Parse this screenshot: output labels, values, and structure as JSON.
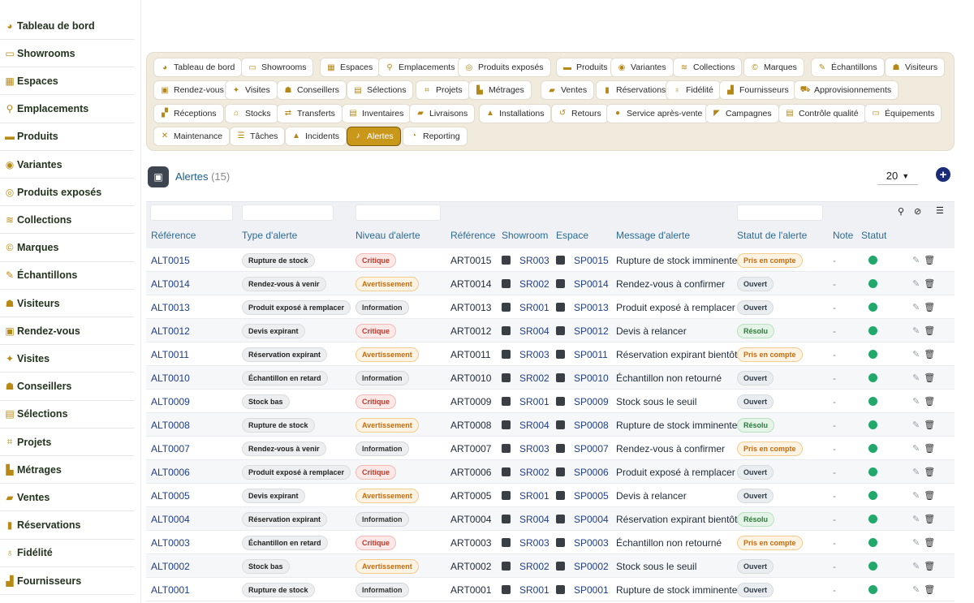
{
  "sidebar": {
    "items": [
      {
        "label": "Tableau de bord",
        "icon": "dashboard-icon",
        "glyph": "◕"
      },
      {
        "label": "Showrooms",
        "icon": "showroom-icon",
        "glyph": "▭"
      },
      {
        "label": "Espaces",
        "icon": "grid-icon",
        "glyph": "▦"
      },
      {
        "label": "Emplacements",
        "icon": "location-pin-icon",
        "glyph": "⚲"
      },
      {
        "label": "Produits",
        "icon": "couch-icon",
        "glyph": "▬"
      },
      {
        "label": "Variantes",
        "icon": "palette-icon",
        "glyph": "◉"
      },
      {
        "label": "Produits exposés",
        "icon": "eye-icon",
        "glyph": "◎"
      },
      {
        "label": "Collections",
        "icon": "layers-icon",
        "glyph": "≋"
      },
      {
        "label": "Marques",
        "icon": "copyright-icon",
        "glyph": "©"
      },
      {
        "label": "Échantillons",
        "icon": "swatch-icon",
        "glyph": "✎"
      },
      {
        "label": "Visiteurs",
        "icon": "users-icon",
        "glyph": "☗"
      },
      {
        "label": "Rendez-vous",
        "icon": "calendar-icon",
        "glyph": "▣"
      },
      {
        "label": "Visites",
        "icon": "walking-icon",
        "glyph": "✦"
      },
      {
        "label": "Conseillers",
        "icon": "user-tie-icon",
        "glyph": "☗"
      },
      {
        "label": "Sélections",
        "icon": "clipboard-icon",
        "glyph": "▤"
      },
      {
        "label": "Projets",
        "icon": "diagram-icon",
        "glyph": "⌗"
      },
      {
        "label": "Métrages",
        "icon": "ruler-icon",
        "glyph": "▙"
      },
      {
        "label": "Ventes",
        "icon": "truck-icon",
        "glyph": "▰"
      },
      {
        "label": "Réservations",
        "icon": "bookmark-icon",
        "glyph": "▮"
      },
      {
        "label": "Fidélité",
        "icon": "award-icon",
        "glyph": "♁"
      },
      {
        "label": "Fournisseurs",
        "icon": "industry-icon",
        "glyph": "▟"
      }
    ]
  },
  "modules": {
    "chips": [
      {
        "label": "Tableau de bord",
        "icon": "dashboard-icon",
        "glyph": "◕",
        "active": false
      },
      {
        "label": "Showrooms",
        "icon": "showroom-icon",
        "glyph": "▭",
        "active": false
      },
      {
        "label": "Espaces",
        "icon": "grid-icon",
        "glyph": "▦",
        "active": false
      },
      {
        "label": "Emplacements",
        "icon": "location-pin-icon",
        "glyph": "⚲",
        "active": false
      },
      {
        "label": "Produits exposés",
        "icon": "eye-icon",
        "glyph": "◎",
        "active": false
      },
      {
        "label": "Produits",
        "icon": "couch-icon",
        "glyph": "▬",
        "active": false
      },
      {
        "label": "Variantes",
        "icon": "palette-icon",
        "glyph": "◉",
        "active": false
      },
      {
        "label": "Collections",
        "icon": "layers-icon",
        "glyph": "≋",
        "active": false
      },
      {
        "label": "Marques",
        "icon": "copyright-icon",
        "glyph": "©",
        "active": false
      },
      {
        "label": "Échantillons",
        "icon": "swatch-icon",
        "glyph": "✎",
        "active": false
      },
      {
        "label": "Visiteurs",
        "icon": "users-icon",
        "glyph": "☗",
        "active": false
      },
      {
        "label": "Rendez-vous",
        "icon": "calendar-icon",
        "glyph": "▣",
        "active": false
      },
      {
        "label": "Visites",
        "icon": "walking-icon",
        "glyph": "✦",
        "active": false
      },
      {
        "label": "Conseillers",
        "icon": "user-tie-icon",
        "glyph": "☗",
        "active": false
      },
      {
        "label": "Sélections",
        "icon": "clipboard-icon",
        "glyph": "▤",
        "active": false
      },
      {
        "label": "Projets",
        "icon": "diagram-icon",
        "glyph": "⌗",
        "active": false
      },
      {
        "label": "Métrages",
        "icon": "ruler-icon",
        "glyph": "▙",
        "active": false
      },
      {
        "label": "Ventes",
        "icon": "truck-icon",
        "glyph": "▰",
        "active": false
      },
      {
        "label": "Réservations",
        "icon": "bookmark-icon",
        "glyph": "▮",
        "active": false
      },
      {
        "label": "Fidélité",
        "icon": "award-icon",
        "glyph": "♁",
        "active": false
      },
      {
        "label": "Fournisseurs",
        "icon": "industry-icon",
        "glyph": "▟",
        "active": false
      },
      {
        "label": "Approvisionnements",
        "icon": "cart-icon",
        "glyph": "⛟",
        "active": false
      },
      {
        "label": "Réceptions",
        "icon": "dolly-icon",
        "glyph": "▞",
        "active": false
      },
      {
        "label": "Stocks",
        "icon": "warehouse-icon",
        "glyph": "⌂",
        "active": false
      },
      {
        "label": "Transferts",
        "icon": "exchange-icon",
        "glyph": "⇄",
        "active": false
      },
      {
        "label": "Inventaires",
        "icon": "clipboard-check-icon",
        "glyph": "▤",
        "active": false
      },
      {
        "label": "Livraisons",
        "icon": "delivery-truck-icon",
        "glyph": "▰",
        "active": false
      },
      {
        "label": "Installations",
        "icon": "toolbox-icon",
        "glyph": "▲",
        "active": false
      },
      {
        "label": "Retours",
        "icon": "undo-icon",
        "glyph": "↺",
        "active": false
      },
      {
        "label": "Service après-vente",
        "icon": "comment-icon",
        "glyph": "●",
        "active": false
      },
      {
        "label": "Campagnes",
        "icon": "megaphone-icon",
        "glyph": "◤",
        "active": false
      },
      {
        "label": "Contrôle qualité",
        "icon": "clipboard-check-icon",
        "glyph": "▤",
        "active": false
      },
      {
        "label": "Équipements",
        "icon": "monitor-icon",
        "glyph": "▭",
        "active": false
      },
      {
        "label": "Maintenance",
        "icon": "tools-icon",
        "glyph": "✕",
        "active": false
      },
      {
        "label": "Tâches",
        "icon": "list-icon",
        "glyph": "☰",
        "active": false
      },
      {
        "label": "Incidents",
        "icon": "warning-icon",
        "glyph": "▲",
        "active": false
      },
      {
        "label": "Alertes",
        "icon": "bell-icon",
        "glyph": "♪",
        "active": true
      },
      {
        "label": "Reporting",
        "icon": "pie-chart-icon",
        "glyph": "◔",
        "active": false
      }
    ]
  },
  "header": {
    "title": "Alertes",
    "count": "(15)",
    "page_size": "20",
    "add_label": "+"
  },
  "table": {
    "columns": [
      "Référence",
      "Type d'alerte",
      "Niveau d'alerte",
      "Référence",
      "Showroom",
      "Espace",
      "Message d'alerte",
      "Statut de l'alerte",
      "Note",
      "Statut"
    ],
    "rows": [
      {
        "ref": "ALT0015",
        "type": "Rupture de stock",
        "level": "Critique",
        "art": "ART0015",
        "showroom": "SR003",
        "espace": "SP0015",
        "message": "Rupture de stock imminente",
        "status": "Pris en compte",
        "note": "-"
      },
      {
        "ref": "ALT0014",
        "type": "Rendez-vous à venir",
        "level": "Avertissement",
        "art": "ART0014",
        "showroom": "SR002",
        "espace": "SP0014",
        "message": "Rendez-vous à confirmer",
        "status": "Ouvert",
        "note": "-"
      },
      {
        "ref": "ALT0013",
        "type": "Produit exposé à remplacer",
        "level": "Information",
        "art": "ART0013",
        "showroom": "SR001",
        "espace": "SP0013",
        "message": "Produit exposé à remplacer",
        "status": "Ouvert",
        "note": "-"
      },
      {
        "ref": "ALT0012",
        "type": "Devis expirant",
        "level": "Critique",
        "art": "ART0012",
        "showroom": "SR004",
        "espace": "SP0012",
        "message": "Devis à relancer",
        "status": "Résolu",
        "note": "-"
      },
      {
        "ref": "ALT0011",
        "type": "Réservation expirant",
        "level": "Avertissement",
        "art": "ART0011",
        "showroom": "SR003",
        "espace": "SP0011",
        "message": "Réservation expirant bientôt",
        "status": "Pris en compte",
        "note": "-"
      },
      {
        "ref": "ALT0010",
        "type": "Échantillon en retard",
        "level": "Information",
        "art": "ART0010",
        "showroom": "SR002",
        "espace": "SP0010",
        "message": "Échantillon non retourné",
        "status": "Ouvert",
        "note": "-"
      },
      {
        "ref": "ALT0009",
        "type": "Stock bas",
        "level": "Critique",
        "art": "ART0009",
        "showroom": "SR001",
        "espace": "SP0009",
        "message": "Stock sous le seuil",
        "status": "Ouvert",
        "note": "-"
      },
      {
        "ref": "ALT0008",
        "type": "Rupture de stock",
        "level": "Avertissement",
        "art": "ART0008",
        "showroom": "SR004",
        "espace": "SP0008",
        "message": "Rupture de stock imminente",
        "status": "Résolu",
        "note": "-"
      },
      {
        "ref": "ALT0007",
        "type": "Rendez-vous à venir",
        "level": "Information",
        "art": "ART0007",
        "showroom": "SR003",
        "espace": "SP0007",
        "message": "Rendez-vous à confirmer",
        "status": "Pris en compte",
        "note": "-"
      },
      {
        "ref": "ALT0006",
        "type": "Produit exposé à remplacer",
        "level": "Critique",
        "art": "ART0006",
        "showroom": "SR002",
        "espace": "SP0006",
        "message": "Produit exposé à remplacer",
        "status": "Ouvert",
        "note": "-"
      },
      {
        "ref": "ALT0005",
        "type": "Devis expirant",
        "level": "Avertissement",
        "art": "ART0005",
        "showroom": "SR001",
        "espace": "SP0005",
        "message": "Devis à relancer",
        "status": "Ouvert",
        "note": "-"
      },
      {
        "ref": "ALT0004",
        "type": "Réservation expirant",
        "level": "Information",
        "art": "ART0004",
        "showroom": "SR004",
        "espace": "SP0004",
        "message": "Réservation expirant bientôt",
        "status": "Résolu",
        "note": "-"
      },
      {
        "ref": "ALT0003",
        "type": "Échantillon en retard",
        "level": "Critique",
        "art": "ART0003",
        "showroom": "SR003",
        "espace": "SP0003",
        "message": "Échantillon non retourné",
        "status": "Pris en compte",
        "note": "-"
      },
      {
        "ref": "ALT0002",
        "type": "Stock bas",
        "level": "Avertissement",
        "art": "ART0002",
        "showroom": "SR002",
        "espace": "SP0002",
        "message": "Stock sous le seuil",
        "status": "Ouvert",
        "note": "-"
      },
      {
        "ref": "ALT0001",
        "type": "Rupture de stock",
        "level": "Information",
        "art": "ART0001",
        "showroom": "SR001",
        "espace": "SP0001",
        "message": "Rupture de stock imminente",
        "status": "Ouvert",
        "note": "-"
      }
    ]
  },
  "colors": {
    "accent": "#c9971a",
    "link": "#1f3e8a",
    "status_active": "#22a86b",
    "add_button": "#1a2b7a"
  }
}
